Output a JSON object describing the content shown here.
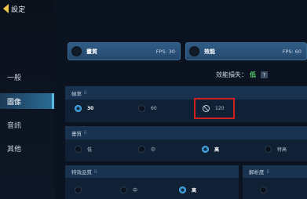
{
  "header": {
    "title": "設定"
  },
  "sidebar": {
    "items": [
      {
        "label": "一般",
        "active": false
      },
      {
        "label": "圖像",
        "active": true
      },
      {
        "label": "音訊",
        "active": false
      },
      {
        "label": "其他",
        "active": false
      }
    ]
  },
  "presets": [
    {
      "label": "畫質",
      "fps": "FPS: 30"
    },
    {
      "label": "效能",
      "fps": "FPS: 60"
    }
  ],
  "performance": {
    "label": "效能損失：",
    "value": "低",
    "help": "?"
  },
  "frame_rate": {
    "title": "幀率",
    "options": [
      "30",
      "60",
      "120"
    ],
    "selected": "30",
    "blocked": "120"
  },
  "quality": {
    "title": "畫質",
    "options": [
      "低",
      "中",
      "高",
      "特高"
    ],
    "selected": "高"
  },
  "effects": {
    "title": "特效品質",
    "options": [
      "",
      "中",
      "高"
    ],
    "selected": "高"
  },
  "resolution": {
    "title": "解析度"
  },
  "colors": {
    "accent": "#2b6e96",
    "preset": "#2f5c86",
    "highlight": "#d11f1f",
    "good": "#56d26c"
  }
}
